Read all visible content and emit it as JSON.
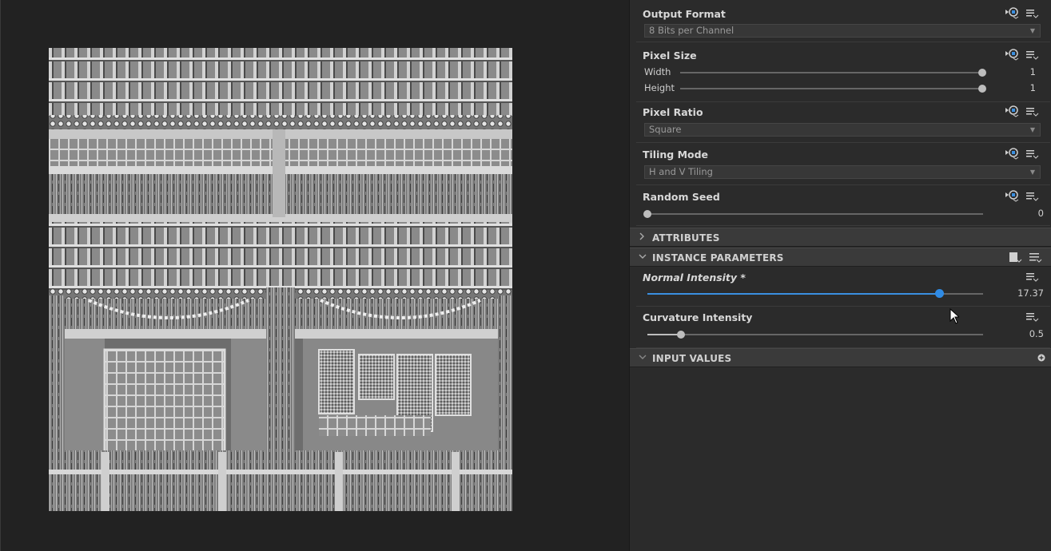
{
  "panel": {
    "output_format": {
      "title": "Output Format",
      "value": "8 Bits per Channel"
    },
    "pixel_size": {
      "title": "Pixel Size",
      "width_label": "Width",
      "width_value": "1",
      "height_label": "Height",
      "height_value": "1"
    },
    "pixel_ratio": {
      "title": "Pixel Ratio",
      "value": "Square"
    },
    "tiling_mode": {
      "title": "Tiling Mode",
      "value": "H and V Tiling"
    },
    "random_seed": {
      "title": "Random Seed",
      "value": "0"
    },
    "sections": {
      "attributes": "ATTRIBUTES",
      "instance_parameters": "INSTANCE PARAMETERS",
      "input_values": "INPUT VALUES"
    },
    "normal_intensity": {
      "title": "Normal Intensity *",
      "value": "17.37",
      "fraction": 0.868
    },
    "curvature_intensity": {
      "title": "Curvature Intensity",
      "value": "0.5",
      "fraction": 0.1
    }
  },
  "icons": {
    "expose": "expose-parameter-icon",
    "menu": "options-menu-icon",
    "collapsed": "chevron-right-icon",
    "expanded": "chevron-down-icon",
    "add": "add-icon",
    "preset": "preset-icon"
  },
  "colors": {
    "accent": "#2f8be5",
    "panel": "#2b2b2b",
    "viewport": "#222222"
  }
}
